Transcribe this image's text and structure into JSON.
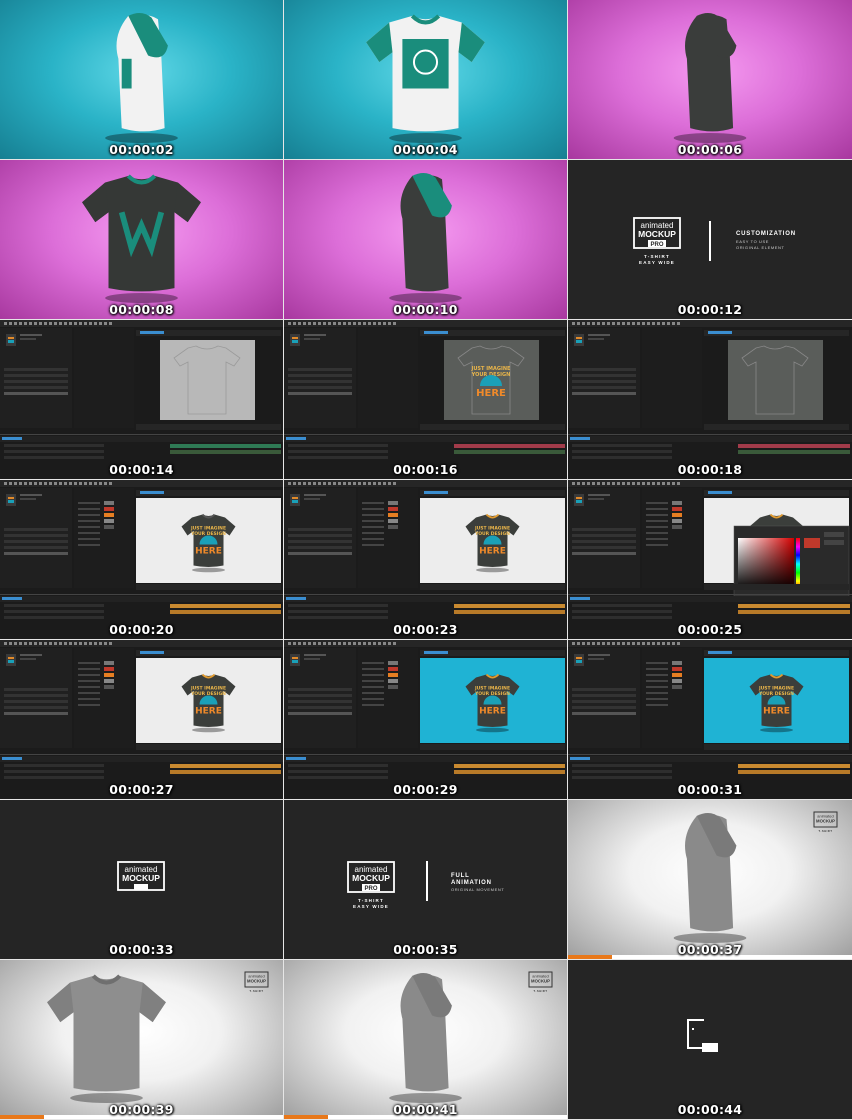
{
  "frames": [
    {
      "time": "00:00:02",
      "scene": "cyan-turntable",
      "shirt": "white-teal-side"
    },
    {
      "time": "00:00:04",
      "scene": "cyan-turntable",
      "shirt": "white-teal-front"
    },
    {
      "time": "00:00:06",
      "scene": "pink-turntable",
      "shirt": "dark-side"
    },
    {
      "time": "00:00:08",
      "scene": "pink-turntable",
      "shirt": "dark-w-front"
    },
    {
      "time": "00:00:10",
      "scene": "pink-turntable",
      "shirt": "dark-side-2"
    },
    {
      "time": "00:00:12",
      "scene": "title-customization"
    },
    {
      "time": "00:00:14",
      "scene": "ae-editor",
      "variant": "flat-template"
    },
    {
      "time": "00:00:16",
      "scene": "ae-editor",
      "variant": "flat-design"
    },
    {
      "time": "00:00:18",
      "scene": "ae-editor",
      "variant": "flat-back"
    },
    {
      "time": "00:00:20",
      "scene": "ae-editor",
      "variant": "3d-grey"
    },
    {
      "time": "00:00:23",
      "scene": "ae-editor",
      "variant": "3d-grey-2"
    },
    {
      "time": "00:00:25",
      "scene": "ae-editor",
      "variant": "color-picker"
    },
    {
      "time": "00:00:27",
      "scene": "ae-editor",
      "variant": "3d-grey-3"
    },
    {
      "time": "00:00:29",
      "scene": "ae-editor",
      "variant": "3d-blue"
    },
    {
      "time": "00:00:31",
      "scene": "ae-editor",
      "variant": "3d-blue-2"
    },
    {
      "time": "00:00:33",
      "scene": "title-logo"
    },
    {
      "time": "00:00:35",
      "scene": "title-full-animation"
    },
    {
      "time": "00:00:37",
      "scene": "white-turntable",
      "shirt": "grey-side"
    },
    {
      "time": "00:00:39",
      "scene": "white-turntable",
      "shirt": "grey-front"
    },
    {
      "time": "00:00:41",
      "scene": "white-turntable",
      "shirt": "grey-side-2"
    },
    {
      "time": "00:00:44",
      "scene": "end-logo"
    }
  ],
  "brand": {
    "line1": "animated",
    "line2": "MOCKUP",
    "pro": "PRO",
    "product": "T-SHIRT",
    "product_sub": "EASY WIDE"
  },
  "title_customization": {
    "heading": "CUSTOMIZATION",
    "sub1": "EASY TO USE",
    "sub2": "ORIGINAL ELEMENT"
  },
  "title_full_animation": {
    "heading1": "FULL",
    "heading2": "ANIMATION",
    "sub1": "ORIGINAL MOVEMENT"
  },
  "design_text": {
    "line1": "JUST IMAGINE",
    "line2": "YOUR DESIGN",
    "line3": "HERE"
  },
  "colors": {
    "cyan": "#2ab3c7",
    "pink": "#dc6ed8",
    "dark": "#252525",
    "teal": "#1a8d7c",
    "orange": "#e8781a",
    "ae_blue": "#1fb3d4"
  }
}
